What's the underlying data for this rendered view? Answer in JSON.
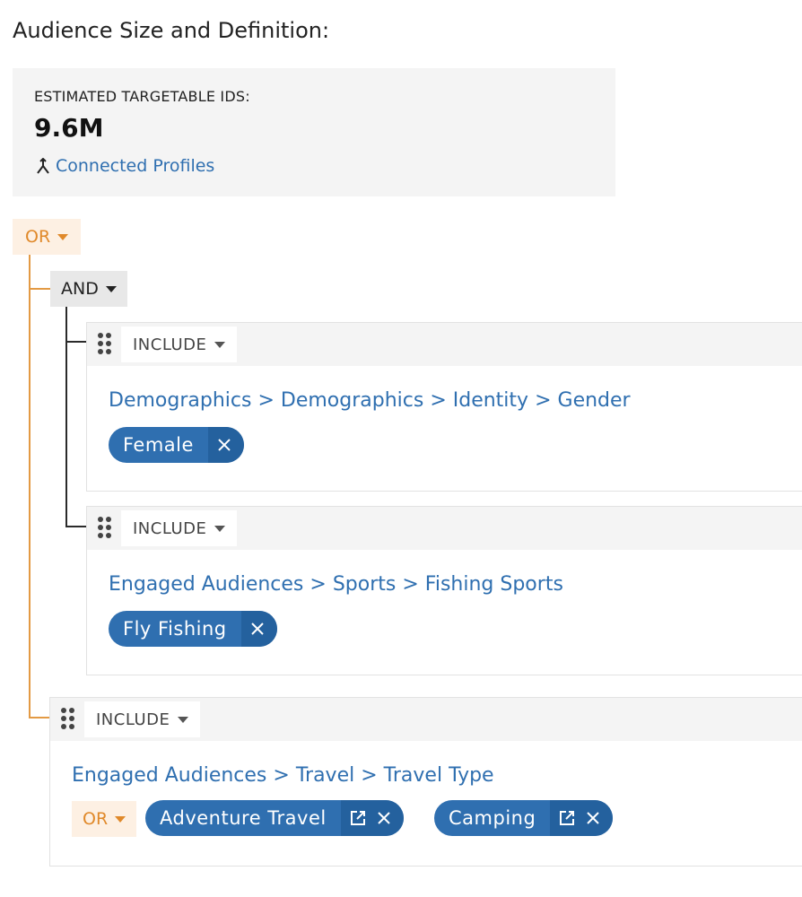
{
  "page": {
    "title": "Audience Size and Definition:"
  },
  "stats": {
    "label": "ESTIMATED TARGETABLE IDS:",
    "value": "9.6M",
    "link_label": "Connected Profiles"
  },
  "tree": {
    "root_operator": "OR",
    "group_operator": "AND",
    "criteria": [
      {
        "mode": "INCLUDE",
        "path": [
          "Demographics",
          "Demographics",
          "Identity",
          "Gender"
        ],
        "chips": [
          {
            "label": "Female"
          }
        ]
      },
      {
        "mode": "INCLUDE",
        "path": [
          "Engaged Audiences",
          "Sports",
          "Fishing Sports"
        ],
        "chips": [
          {
            "label": "Fly Fishing"
          }
        ]
      },
      {
        "mode": "INCLUDE",
        "path": [
          "Engaged Audiences",
          "Travel",
          "Travel Type"
        ],
        "value_operator": "OR",
        "chips": [
          {
            "label": "Adventure Travel"
          },
          {
            "label": "Camping"
          }
        ]
      }
    ],
    "separator": ">"
  },
  "icons": {
    "connected": "merge-arrow-icon",
    "drag": "drag-handle-icon",
    "remove": "close-icon",
    "open": "external-link-icon"
  },
  "colors": {
    "link_blue": "#2f6fb0",
    "chip_blue": "#2f6fb0",
    "or_orange": "#e0892a",
    "and_gray": "#e8e8e8"
  }
}
